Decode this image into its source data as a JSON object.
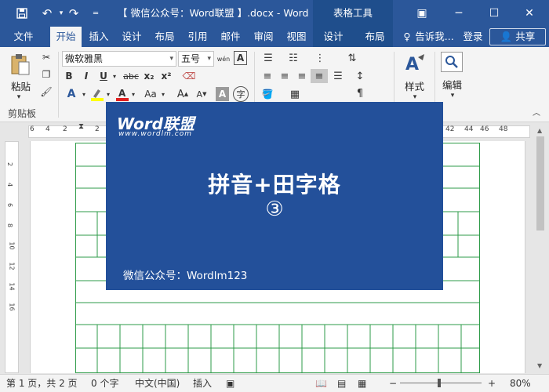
{
  "titlebar": {
    "document_title": "【 微信公众号：Word联盟 】.docx - Word",
    "context_title": "表格工具"
  },
  "tabs": {
    "file": "文件",
    "home": "开始",
    "insert": "插入",
    "design": "设计",
    "layout": "布局",
    "references": "引用",
    "mailings": "邮件",
    "review": "审阅",
    "view": "视图",
    "table_design": "设计",
    "table_layout": "布局",
    "tell_me": "告诉我...",
    "signin": "登录",
    "share": "共享"
  },
  "ribbon": {
    "paste_label": "粘贴",
    "clipboard_label": "剪贴板",
    "font_name": "微软雅黑",
    "font_size": "五号",
    "styles_label": "样式",
    "editing_label": "编辑",
    "bold": "B",
    "italic": "I",
    "underline": "U",
    "strikethrough": "abc",
    "subscript": "x₂",
    "superscript": "x²",
    "font_color_a": "A",
    "change_case": "Aa",
    "grow_font": "A",
    "shrink_font": "A",
    "char_shading": "A",
    "enclose_char": "字",
    "phonetic_guide": "wén",
    "char_border": "A"
  },
  "ruler": {
    "numbers": [
      "6",
      "4",
      "2",
      "2",
      "42",
      "44",
      "46",
      "48"
    ]
  },
  "vruler": {
    "numbers": [
      "2",
      "4",
      "6",
      "8",
      "10",
      "12",
      "14",
      "16"
    ]
  },
  "overlay": {
    "logo": "Word联盟",
    "logo_sub": "www.wordlm.com",
    "headline": "拼音+田字格",
    "circled_number": "③",
    "wechat": "微信公众号：Wordlm123"
  },
  "statusbar": {
    "page_info": "第 1 页，共 2 页",
    "word_count": "0 个字",
    "language": "中文(中国)",
    "mode": "插入",
    "zoom": "80%",
    "zoom_out": "−",
    "zoom_in": "+"
  },
  "colors": {
    "word_blue": "#2b579a",
    "overlay_blue": "#23509a",
    "grid_green": "#2e9b48"
  }
}
